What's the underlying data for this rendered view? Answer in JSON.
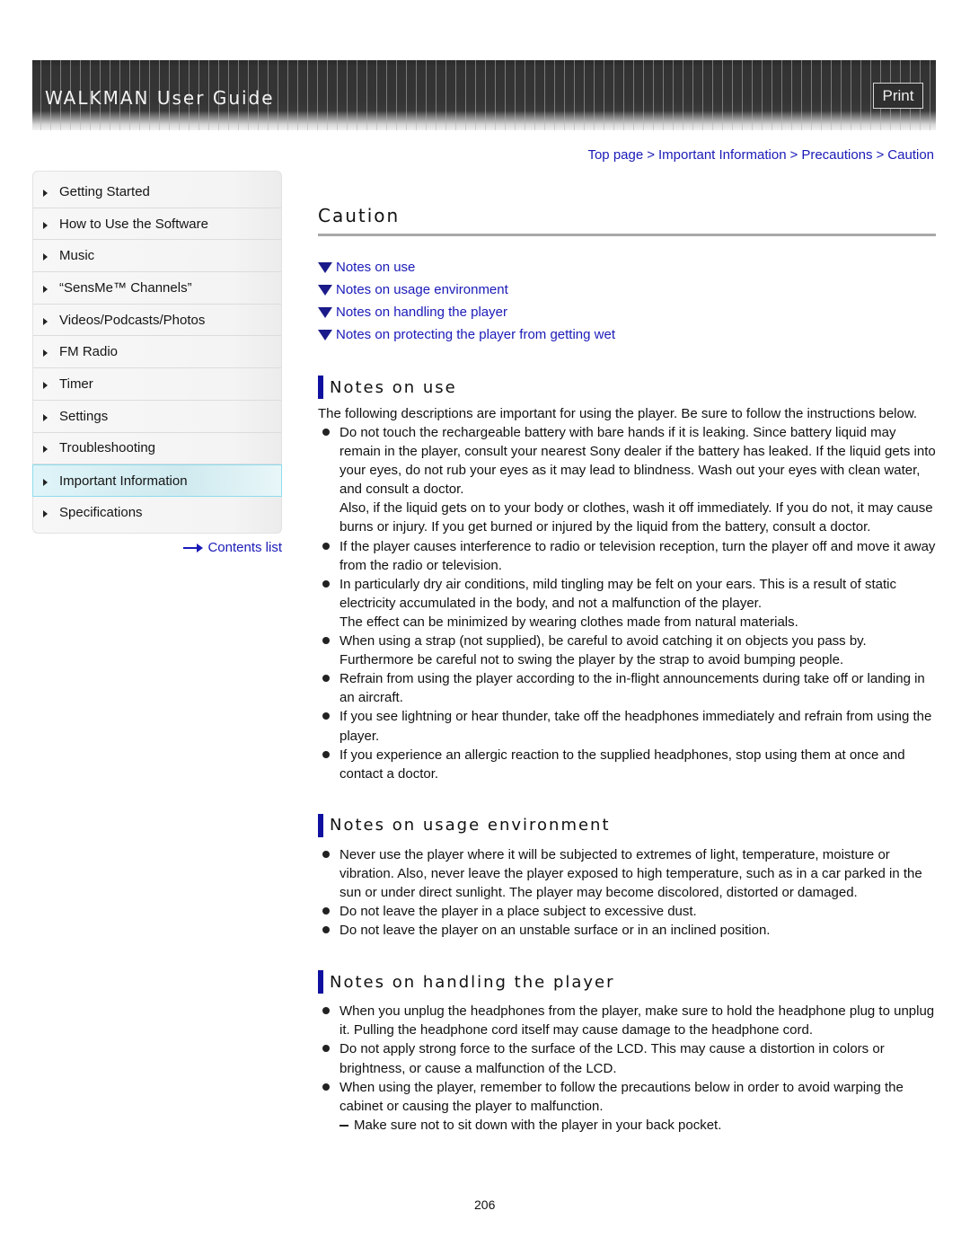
{
  "header": {
    "title": "WALKMAN User Guide",
    "print_label": "Print"
  },
  "breadcrumb": [
    {
      "label": "Top page"
    },
    {
      "label": "Important Information"
    },
    {
      "label": "Precautions"
    },
    {
      "label": "Caution"
    }
  ],
  "breadcrumb_separator": ">",
  "sidebar": {
    "items": [
      {
        "label": "Getting Started"
      },
      {
        "label": "How to Use the Software"
      },
      {
        "label": "Music"
      },
      {
        "label": "“SensMe™ Channels”"
      },
      {
        "label": "Videos/Podcasts/Photos"
      },
      {
        "label": "FM Radio"
      },
      {
        "label": "Timer"
      },
      {
        "label": "Settings"
      },
      {
        "label": "Troubleshooting"
      },
      {
        "label": "Important Information",
        "active": true
      },
      {
        "label": "Specifications"
      }
    ],
    "contents_link": "Contents list"
  },
  "colors": {
    "link": "#1a1ab8",
    "heading_bar": "#1010a0",
    "active_nav": "#cfeaef"
  },
  "main": {
    "title": "Caution",
    "toc": [
      "Notes on use",
      "Notes on usage environment",
      "Notes on handling the player",
      "Notes on protecting the player from getting wet"
    ],
    "sections": [
      {
        "heading": "Notes on use",
        "intro": "The following descriptions are important for using the player. Be sure to follow the instructions below.",
        "bullets": [
          {
            "text": "Do not touch the rechargeable battery with bare hands if it is leaking. Since battery liquid may remain in the player, consult your nearest Sony dealer if the battery has leaked. If the liquid gets into your eyes, do not rub your eyes as it may lead to blindness. Wash out your eyes with clean water, and consult a doctor.",
            "extra": "Also, if the liquid gets on to your body or clothes, wash it off immediately. If you do not, it may cause burns or injury. If you get burned or injured by the liquid from the battery, consult a doctor."
          },
          {
            "text": "If the player causes interference to radio or television reception, turn the player off and move it away from the radio or television."
          },
          {
            "text": "In particularly dry air conditions, mild tingling may be felt on your ears. This is a result of static electricity accumulated in the body, and not a malfunction of the player.",
            "extra": "The effect can be minimized by wearing clothes made from natural materials."
          },
          {
            "text": "When using a strap (not supplied), be careful to avoid catching it on objects you pass by. Furthermore be careful not to swing the player by the strap to avoid bumping people."
          },
          {
            "text": "Refrain from using the player according to the in-flight announcements during take off or landing in an aircraft."
          },
          {
            "text": "If you see lightning or hear thunder, take off the headphones immediately and refrain from using the player."
          },
          {
            "text": "If you experience an allergic reaction to the supplied headphones, stop using them at once and contact a doctor."
          }
        ]
      },
      {
        "heading": "Notes on usage environment",
        "bullets": [
          {
            "text": "Never use the player where it will be subjected to extremes of light, temperature, moisture or vibration. Also, never leave the player exposed to high temperature, such as in a car parked in the sun or under direct sunlight. The player may become discolored, distorted or damaged."
          },
          {
            "text": "Do not leave the player in a place subject to excessive dust."
          },
          {
            "text": "Do not leave the player on an unstable surface or in an inclined position."
          }
        ]
      },
      {
        "heading": "Notes on handling the player",
        "bullets": [
          {
            "text": "When you unplug the headphones from the player, make sure to hold the headphone plug to unplug it. Pulling the headphone cord itself may cause damage to the headphone cord."
          },
          {
            "text": "Do not apply strong force to the surface of the LCD. This may cause a distortion in colors or brightness, or cause a malfunction of the LCD."
          },
          {
            "text": "When using the player, remember to follow the precautions below in order to avoid warping the cabinet or causing the player to malfunction.",
            "dash": "Make sure not to sit down with the player in your back pocket."
          }
        ]
      }
    ]
  },
  "page_number": "206"
}
